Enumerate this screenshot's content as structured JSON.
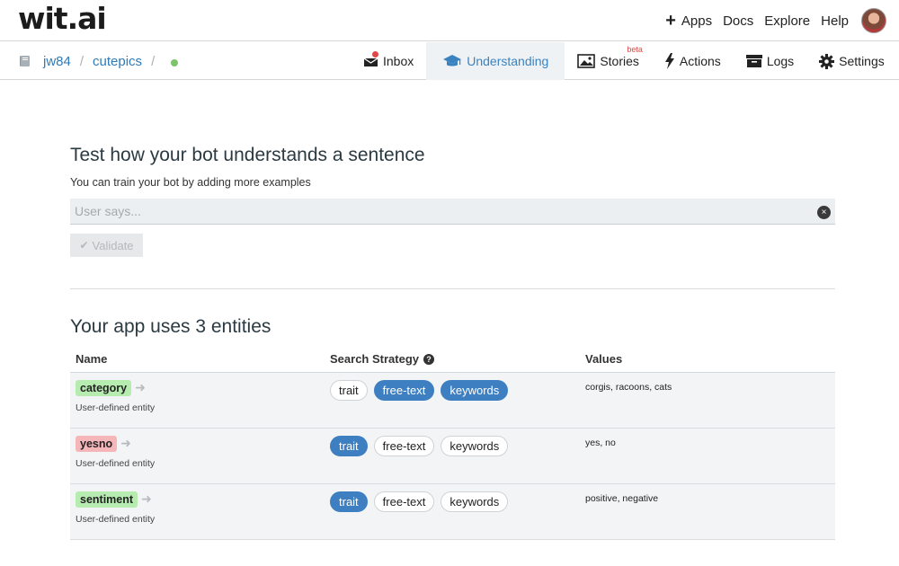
{
  "logo": "wit.ai",
  "topnav": {
    "plus": "+",
    "apps": "Apps",
    "docs": "Docs",
    "explore": "Explore",
    "help": "Help"
  },
  "breadcrumb": {
    "user": "jw84",
    "sep1": "/",
    "app": "cutepics",
    "sep2": "/"
  },
  "tabs": {
    "inbox": "Inbox",
    "understanding": "Understanding",
    "stories": "Stories",
    "stories_badge": "beta",
    "actions": "Actions",
    "logs": "Logs",
    "settings": "Settings"
  },
  "test": {
    "title": "Test how your bot understands a sentence",
    "subtitle": "You can train your bot by adding more examples",
    "placeholder": "User says...",
    "clear_icon": "×",
    "validate": "Validate",
    "validate_check": "✔"
  },
  "entities": {
    "title": "Your app uses 3 entities",
    "headers": {
      "name": "Name",
      "strategy": "Search Strategy",
      "help": "?",
      "values": "Values"
    },
    "strategy_labels": [
      "trait",
      "free-text",
      "keywords"
    ],
    "rows": [
      {
        "name": "category",
        "tag_color": "#b7ecb1",
        "desc": "User-defined entity",
        "active": [
          "free-text",
          "keywords"
        ],
        "values": "corgis, racoons, cats"
      },
      {
        "name": "yesno",
        "tag_color": "#f5b6ba",
        "desc": "User-defined entity",
        "active": [
          "trait"
        ],
        "values": "yes, no"
      },
      {
        "name": "sentiment",
        "tag_color": "#b7ecb1",
        "desc": "User-defined entity",
        "active": [
          "trait"
        ],
        "values": "positive, negative"
      }
    ]
  },
  "colors": {
    "accent": "#3d7fc1",
    "status_ok": "#7bc46a",
    "badge_red": "#e04848"
  }
}
